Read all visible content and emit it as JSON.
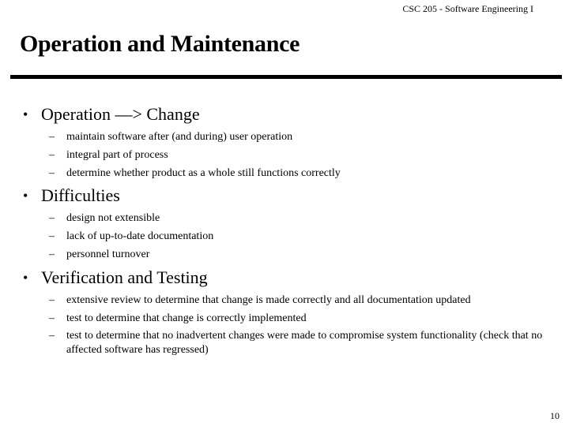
{
  "header": {
    "course": "CSC 205 - Software Engineering I"
  },
  "slide": {
    "title": "Operation and Maintenance",
    "bullet_icon": "bullet-dot",
    "dash_icon": "en-dash",
    "sections": [
      {
        "heading": "Operation —> Change",
        "items": [
          "maintain software after (and during) user operation",
          "integral part of process",
          "determine whether product as a whole still functions correctly"
        ]
      },
      {
        "heading": "Difficulties",
        "items": [
          "design not extensible",
          "lack of up-to-date documentation",
          "personnel turnover"
        ]
      },
      {
        "heading": "Verification and Testing",
        "items": [
          "extensive review  to determine that change is made correctly and all documentation updated",
          "test to determine that change is correctly implemented",
          "test to determine that no inadvertent changes were made to compromise system functionality (check that no affected software has regressed)"
        ]
      }
    ],
    "page_number": "10"
  },
  "glyphs": {
    "bullet": "•",
    "dash": "–"
  }
}
